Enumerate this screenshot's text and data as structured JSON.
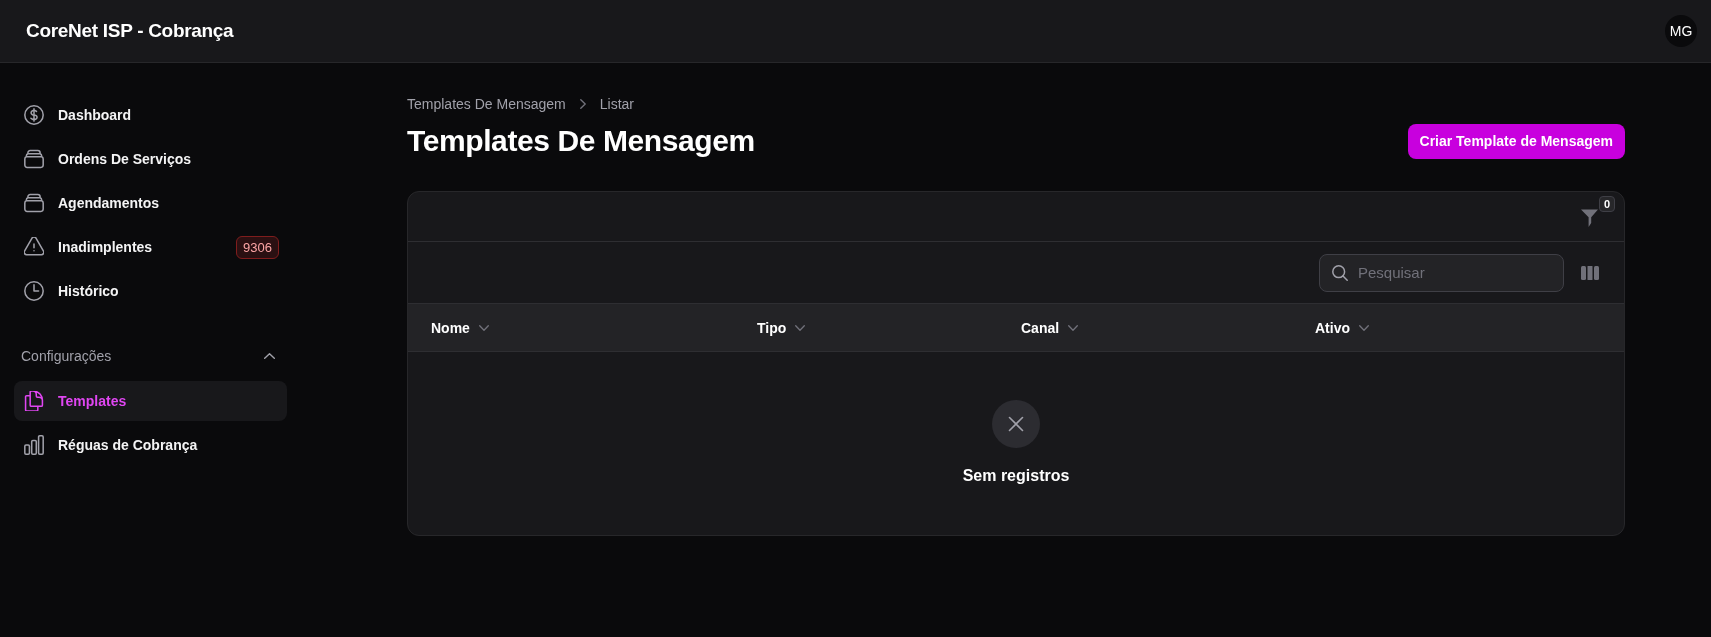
{
  "app_bar": {
    "title": "CoreNet ISP - Cobrança",
    "avatar": "MG"
  },
  "sidebar": {
    "items": [
      {
        "label": "Dashboard",
        "selected": false
      },
      {
        "label": "Ordens De Serviços",
        "selected": false
      },
      {
        "label": "Agendamentos",
        "selected": false
      },
      {
        "label": "Inadimplentes",
        "selected": false,
        "badge": "9306"
      },
      {
        "label": "Histórico",
        "selected": false
      }
    ],
    "groups": [
      {
        "label": "Configurações",
        "expanded": true,
        "items": [
          {
            "label": "Templates",
            "selected": true
          },
          {
            "label": "Réguas de Cobrança",
            "selected": false
          }
        ]
      }
    ]
  },
  "breadcrumbs": [
    "Templates De Mensagem",
    "Listar"
  ],
  "page": {
    "title": "Templates De Mensagem",
    "primary_action": "Criar Template de Mensagem"
  },
  "table": {
    "filter_count": "0",
    "search": {
      "placeholder": "Pesquisar"
    },
    "columns": [
      {
        "label": "Nome"
      },
      {
        "label": "Tipo"
      },
      {
        "label": "Canal"
      },
      {
        "label": "Ativo"
      }
    ],
    "empty_message": "Sem registros"
  }
}
